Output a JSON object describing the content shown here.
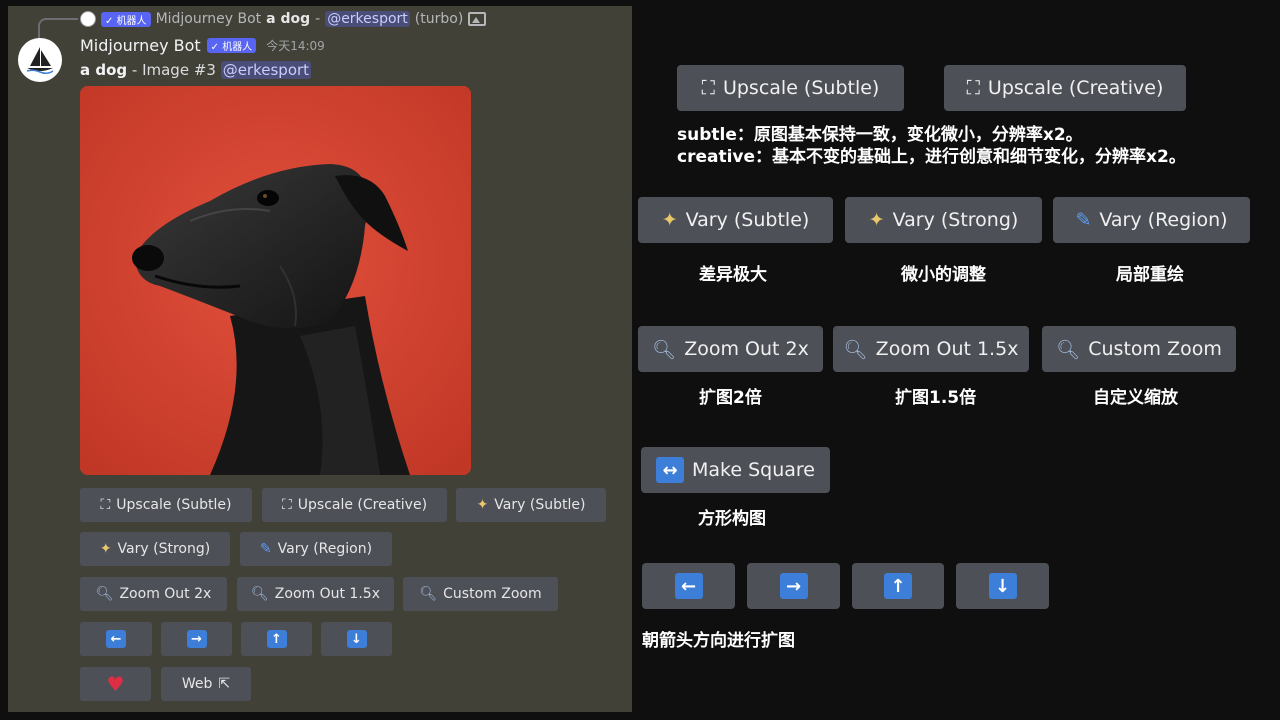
{
  "reply": {
    "bot_tag": "✓ 机器人",
    "author": "Midjourney Bot",
    "prompt": "a dog",
    "separator": "-",
    "mention": "@erkesport",
    "mode": "(turbo)"
  },
  "message": {
    "author": "Midjourney Bot",
    "bot_tag": "✓ 机器人",
    "time": "今天14:09",
    "prompt": "a dog",
    "image_label": " - Image #3 ",
    "mention": "@erkesport"
  },
  "discord_buttons": {
    "upscale_subtle": "Upscale (Subtle)",
    "upscale_creative": "Upscale (Creative)",
    "vary_subtle": "Vary (Subtle)",
    "vary_strong": "Vary (Strong)",
    "vary_region": "Vary (Region)",
    "zoom_2x": "Zoom Out 2x",
    "zoom_15x": "Zoom Out 1.5x",
    "custom_zoom": "Custom Zoom",
    "web": "Web"
  },
  "right": {
    "upscale_subtle": "Upscale (Subtle)",
    "upscale_creative": "Upscale (Creative)",
    "note_line1": "subtle：原图基本保持一致，变化微小，分辨率x2。",
    "note_line2": "creative：基本不变的基础上，进行创意和细节变化，分辨率x2。",
    "vary_subtle": "Vary (Subtle)",
    "vary_strong": "Vary (Strong)",
    "vary_region": "Vary (Region)",
    "vary_subtle_desc": "差异极大",
    "vary_strong_desc": "微小的调整",
    "vary_region_desc": "局部重绘",
    "zoom_2x": "Zoom Out 2x",
    "zoom_15x": "Zoom Out 1.5x",
    "custom_zoom": "Custom Zoom",
    "zoom_2x_desc": "扩图2倍",
    "zoom_15x_desc": "扩图1.5倍",
    "custom_zoom_desc": "自定义缩放",
    "make_square": "Make Square",
    "make_square_desc": "方形构图",
    "arrows_desc": "朝箭头方向进行扩图"
  },
  "icons": {
    "arrow_left": "←",
    "arrow_right": "→",
    "arrow_up": "↑",
    "arrow_down": "↓",
    "make_square": "↔"
  },
  "colors": {
    "left_bg": "#424138",
    "right_bg": "#0f0f10",
    "button": "#4e5058",
    "blurple": "#5865f2",
    "arrow_blue": "#3d7fd8",
    "image_bg": "#d4412f"
  }
}
